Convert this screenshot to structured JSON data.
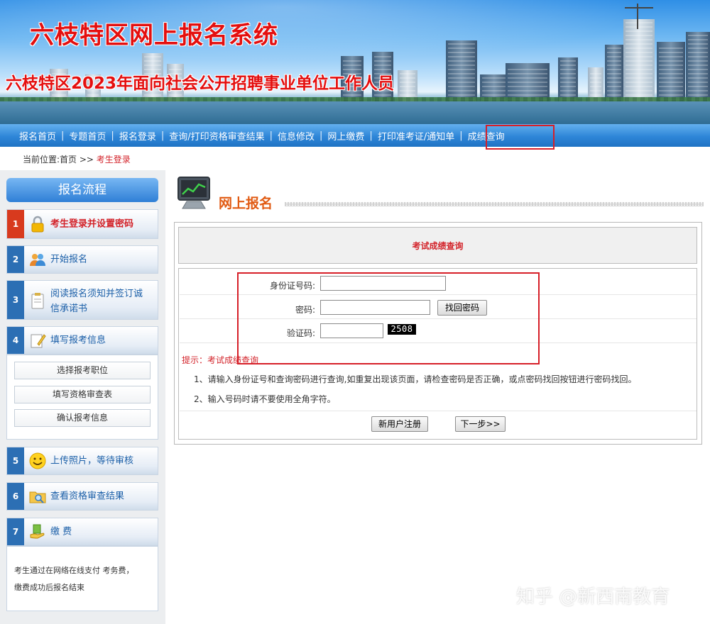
{
  "header": {
    "system_title": "六枝特区网上报名系统",
    "subtitle": "六枝特区2023年面向社会公开招聘事业单位工作人员"
  },
  "nav": {
    "items": [
      "报名首页",
      "专题首页",
      "报名登录",
      "查询/打印资格审查结果",
      "信息修改",
      "网上缴费",
      "打印准考证/通知单",
      "成绩查询"
    ],
    "separator": "|",
    "highlighted_item": "成绩查询"
  },
  "breadcrumb": {
    "prefix": "当前位置:首页 >> ",
    "current": "考生登录"
  },
  "sidebar": {
    "title": "报名流程",
    "steps": [
      {
        "num": "1",
        "label": "考生登录并设置密码",
        "icon": "lock-icon",
        "active": true
      },
      {
        "num": "2",
        "label": "开始报名",
        "icon": "users-icon"
      },
      {
        "num": "3",
        "label": "阅读报名须知并签订诚信承诺书",
        "label_line1": "阅读报名须知并签订诚",
        "label_line2": "信承诺书",
        "icon": "clipboard-icon"
      },
      {
        "num": "4",
        "label": "填写报考信息",
        "icon": "pencil-doc-icon"
      },
      {
        "num": "5",
        "label": "上传照片，等待审核",
        "icon": "smiley-icon"
      },
      {
        "num": "6",
        "label": "查看资格审查结果",
        "icon": "folder-search-icon"
      },
      {
        "num": "7",
        "label": "缴 费",
        "icon": "money-hand-icon"
      }
    ],
    "step4_buttons": [
      "选择报考职位",
      "填写资格审查表",
      "确认报考信息"
    ],
    "payment_note_line1": "考生通过在网络在线支付 考务费，",
    "payment_note_line2": "缴费成功后报名结束"
  },
  "main": {
    "section_title": "网上报名",
    "panel_title": "考试成绩查询",
    "form": {
      "id_label": "身份证号码:",
      "id_value": "",
      "password_label": "密码:",
      "password_value": "",
      "recover_button": "找回密码",
      "captcha_label": "验证码:",
      "captcha_value": "",
      "captcha_image_text": "2508"
    },
    "tip": "提示：考试成绩查询",
    "notes": [
      "1、请输入身份证号和查询密码进行查询,如重复出现该页面，请检查密码是否正确，或点密码找回按钮进行密码找回。",
      "2、输入号码时请不要使用全角字符。"
    ],
    "register_button": "新用户注册",
    "next_button": "下一步>>"
  },
  "watermark": "知乎 @新西南教育",
  "colors": {
    "title_red": "#e40f0f",
    "nav_blue": "#2e86d8",
    "accent_orange": "#e15a12",
    "highlight_red": "#d71f28"
  }
}
